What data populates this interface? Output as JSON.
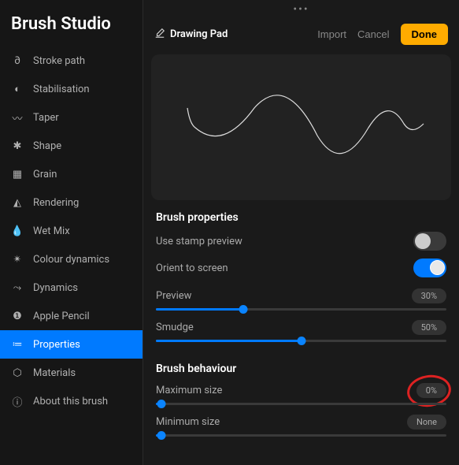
{
  "app_title": "Brush Studio",
  "sidebar": {
    "items": [
      {
        "id": "stroke-path",
        "label": "Stroke path",
        "icon": "∂"
      },
      {
        "id": "stabilisation",
        "label": "Stabilisation",
        "icon": "◐"
      },
      {
        "id": "taper",
        "label": "Taper",
        "icon": "〰"
      },
      {
        "id": "shape",
        "label": "Shape",
        "icon": "✱"
      },
      {
        "id": "grain",
        "label": "Grain",
        "icon": "▦"
      },
      {
        "id": "rendering",
        "label": "Rendering",
        "icon": "◭"
      },
      {
        "id": "wet-mix",
        "label": "Wet Mix",
        "icon": "💧"
      },
      {
        "id": "colour-dynamics",
        "label": "Colour dynamics",
        "icon": "✴"
      },
      {
        "id": "dynamics",
        "label": "Dynamics",
        "icon": "⤳"
      },
      {
        "id": "apple-pencil",
        "label": "Apple Pencil",
        "icon": "❶"
      },
      {
        "id": "properties",
        "label": "Properties",
        "icon": "≔",
        "active": true
      },
      {
        "id": "materials",
        "label": "Materials",
        "icon": "⬡"
      },
      {
        "id": "about",
        "label": "About this brush",
        "icon": "ⓘ"
      }
    ]
  },
  "header": {
    "drawing_pad": "Drawing Pad",
    "import": "Import",
    "cancel": "Cancel",
    "done": "Done"
  },
  "sections": {
    "properties": {
      "title": "Brush properties",
      "stamp_preview_label": "Use stamp preview",
      "orient_label": "Orient to screen",
      "preview_label": "Preview",
      "preview_value": "30%",
      "preview_pct": 30,
      "smudge_label": "Smudge",
      "smudge_value": "50%",
      "smudge_pct": 50
    },
    "behaviour": {
      "title": "Brush behaviour",
      "max_label": "Maximum size",
      "max_value": "0%",
      "max_pct": 0,
      "min_label": "Minimum size",
      "min_value": "None",
      "min_pct": 0
    }
  }
}
